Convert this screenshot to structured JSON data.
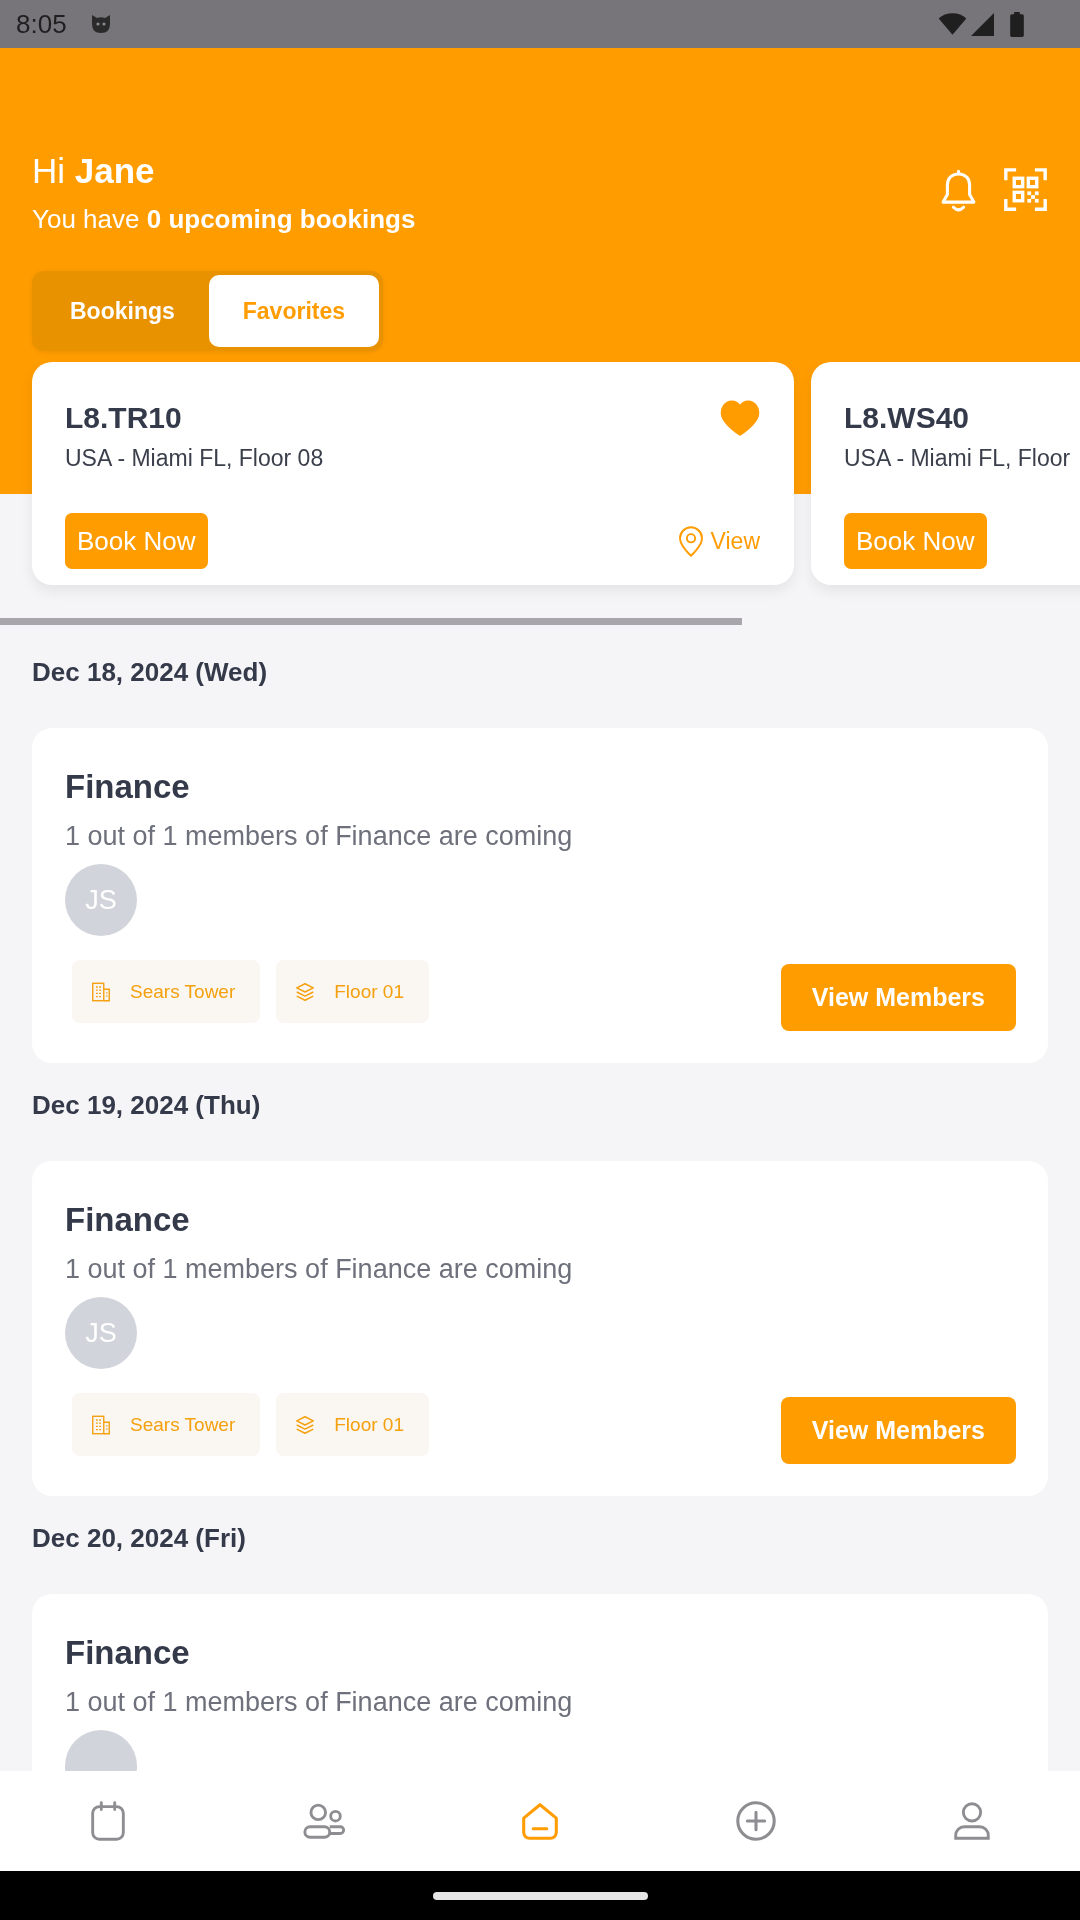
{
  "status_bar": {
    "time": "8:05"
  },
  "header": {
    "greeting": "Hi **Jane**",
    "summary": "You have **0 upcoming bookings**"
  },
  "tabs": [
    {
      "label": "Bookings",
      "selected": false
    },
    {
      "label": "Favorites",
      "selected": true
    }
  ],
  "favorites": [
    {
      "name": "L8.TR10",
      "location": "USA - Miami FL, Floor 08",
      "favorite": true,
      "book_label": "Book Now",
      "view_label": "View"
    },
    {
      "name": "L8.WS40",
      "location": "USA - Miami FL, Floor",
      "book_label": "Book Now"
    }
  ],
  "days": [
    {
      "date": "Dec 18, 2024 (Wed)",
      "group": {
        "title": "Finance",
        "summary": "1 out of 1 members of Finance are coming",
        "members": [
          {
            "kind": "initials",
            "initials": "JS"
          }
        ],
        "tags": [
          {
            "kind": "building",
            "label": "Sears Tower"
          },
          {
            "kind": "floor",
            "label": "Floor 01"
          }
        ],
        "action": "View Members"
      }
    },
    {
      "date": "Dec 19, 2024 (Thu)",
      "group": {
        "title": "Finance",
        "summary": "1 out of 1 members of Finance are coming",
        "members": [
          {
            "kind": "initials",
            "initials": "JS"
          }
        ],
        "tags": [
          {
            "kind": "building",
            "label": "Sears Tower"
          },
          {
            "kind": "floor",
            "label": "Floor 01"
          }
        ],
        "action": "View Members"
      }
    },
    {
      "date": "Dec 20, 2024 (Fri)",
      "group": {
        "title": "Finance",
        "summary": "1 out of 1 members of Finance are coming",
        "members": [
          {
            "kind": "blank"
          }
        ]
      }
    }
  ],
  "bottom_nav": [
    {
      "selected": false
    },
    {
      "selected": false
    },
    {
      "selected": true
    },
    {
      "selected": false
    },
    {
      "selected": false
    }
  ]
}
